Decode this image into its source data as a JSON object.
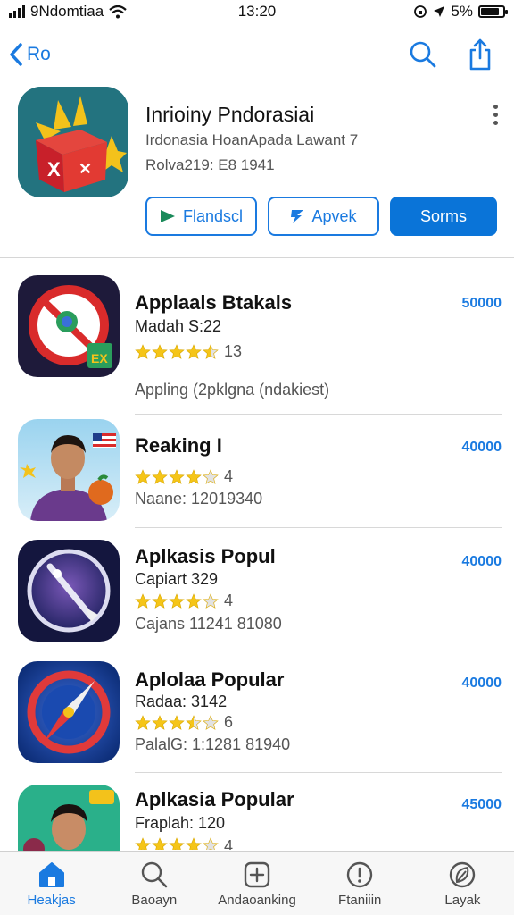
{
  "status_bar": {
    "carrier": "9Ndomtiaa",
    "time": "13:20",
    "battery": "5%",
    "battery_level": 0.85
  },
  "nav": {
    "back_label": "Ro"
  },
  "app": {
    "title": "Inrioiny Pndorasiai",
    "subtitle": "Irdonasia HoanApada Lawant 7",
    "meta": "Rolva219: E8 1941",
    "buttons": {
      "primary_outline": "Flandscl",
      "secondary_outline": "Apvek",
      "solid": "Sorms"
    }
  },
  "list": [
    {
      "title": "Applaals Btakals",
      "subtitle": "Madah S:22",
      "rating_count": "13",
      "rating": 4.5,
      "extra": "Appling (2pklgna  (ndakiest)",
      "price": "50000"
    },
    {
      "title": "Reaking I",
      "subtitle": "",
      "rating_count": "4",
      "rating": 4,
      "extra": "Naane: 12019340",
      "price": "40000"
    },
    {
      "title": "Aplkasis Popul",
      "subtitle": "Capiart 329",
      "rating_count": "4",
      "rating": 4,
      "extra": "Cajans 11241 81080",
      "price": "40000"
    },
    {
      "title": "Aplolaa Popular",
      "subtitle": "Radaa: 3142",
      "rating_count": "6",
      "rating": 3.5,
      "extra": "PalalG: 1:1281 81940",
      "price": "40000"
    },
    {
      "title": "Aplkasia Popular",
      "subtitle": "Fraplah: 120",
      "rating_count": "4",
      "rating": 4,
      "extra": "",
      "price": "45000"
    }
  ],
  "tabs": [
    {
      "label": "Heakjas",
      "icon": "home-icon",
      "active": true
    },
    {
      "label": "Baoayn",
      "icon": "search-icon",
      "active": false
    },
    {
      "label": "Andaoanking",
      "icon": "plus-square-icon",
      "active": false
    },
    {
      "label": "Ftaniiin",
      "icon": "info-circle-icon",
      "active": false
    },
    {
      "label": "Layak",
      "icon": "leaf-icon",
      "active": false
    }
  ],
  "colors": {
    "accent": "#1a7ae0",
    "button_solid": "#0a74d8",
    "star": "#f5c518"
  }
}
